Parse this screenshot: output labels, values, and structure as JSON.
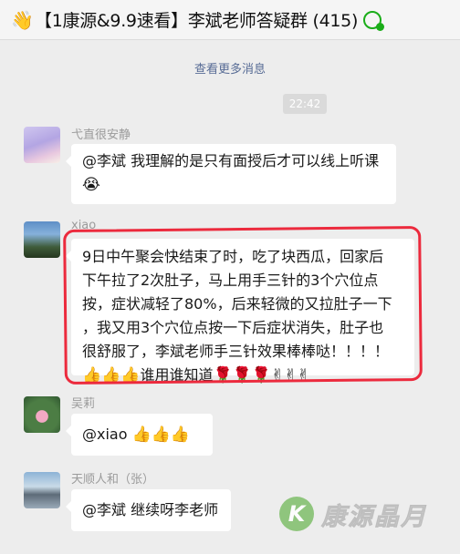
{
  "header": {
    "icon": "waving-hand",
    "icon_glyph": "👋",
    "title": "【1康源&9.9速看】李斌老师答疑群 (415)"
  },
  "more_link": "查看更多消息",
  "timestamp": "22:42",
  "messages": [
    {
      "sender": "弋直很安静",
      "lines": [
        "@李斌 我理解的是只有面授后才可以线上听课"
      ],
      "emoji": "😭"
    },
    {
      "sender": "xiao",
      "lines": [
        "9日中午聚会快结束了时，吃了块西瓜，回家后",
        "下午拉了2次肚子，马上用手三针的3个穴位点",
        "按，症状减轻了80%，后来轻微的又拉肚子一下",
        "，我又用3个穴位点按一下后症状消失，肚子也",
        "很舒服了，李斌老师手三针效果棒棒哒！！！！"
      ],
      "last_line_prefix": "👍👍👍",
      "last_line_text": "谁用谁知道",
      "last_line_suffix": "🌹🌹🌹✌✌✌"
    },
    {
      "sender": "吴莉",
      "text": "@xiao ",
      "emoji": "👍👍👍"
    },
    {
      "sender": "天顺人和（张）",
      "text": "@李斌 继续呀李老师"
    }
  ],
  "watermark": {
    "logo_letter": "K",
    "text": "康源晶月"
  },
  "colors": {
    "link": "#576b95",
    "highlight_box": "#ec2a3d",
    "background": "#ededed"
  }
}
